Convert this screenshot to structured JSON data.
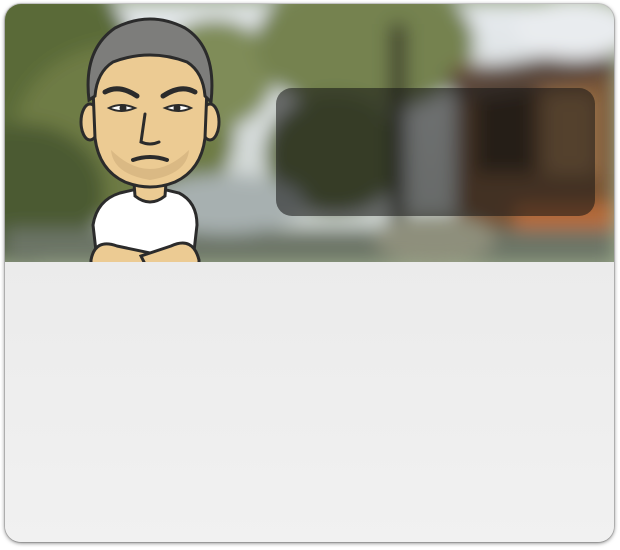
{
  "colors": {
    "panel": "#ececec",
    "overlay": "rgba(20,20,20,0.55)",
    "sky": "#dfe3e6",
    "foliage": "#6f7d4a",
    "wood": "#8a5a34"
  },
  "icons": {
    "avatar": "bitmoji-avatar-icon"
  }
}
